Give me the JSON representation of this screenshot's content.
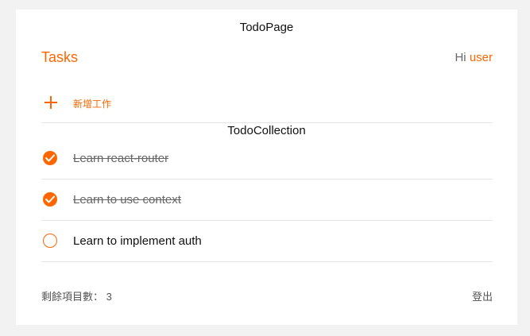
{
  "page_title": "TodoPage",
  "header": {
    "tasks_title": "Tasks",
    "greeting_hi": "Hi",
    "greeting_user": "user"
  },
  "add_todo": {
    "label": "新增工作",
    "icon": "plus-icon"
  },
  "collection_title": "TodoCollection",
  "todos": [
    {
      "title": "Learn react-router",
      "done": true
    },
    {
      "title": "Learn to use context",
      "done": true
    },
    {
      "title": "Learn to implement auth",
      "done": false
    }
  ],
  "footer": {
    "remaining_label": "剩餘項目數：",
    "remaining_count": "3",
    "logout_label": "登出"
  },
  "colors": {
    "accent": "#ff6600",
    "background": "#f2f2f2",
    "card": "#ffffff"
  }
}
